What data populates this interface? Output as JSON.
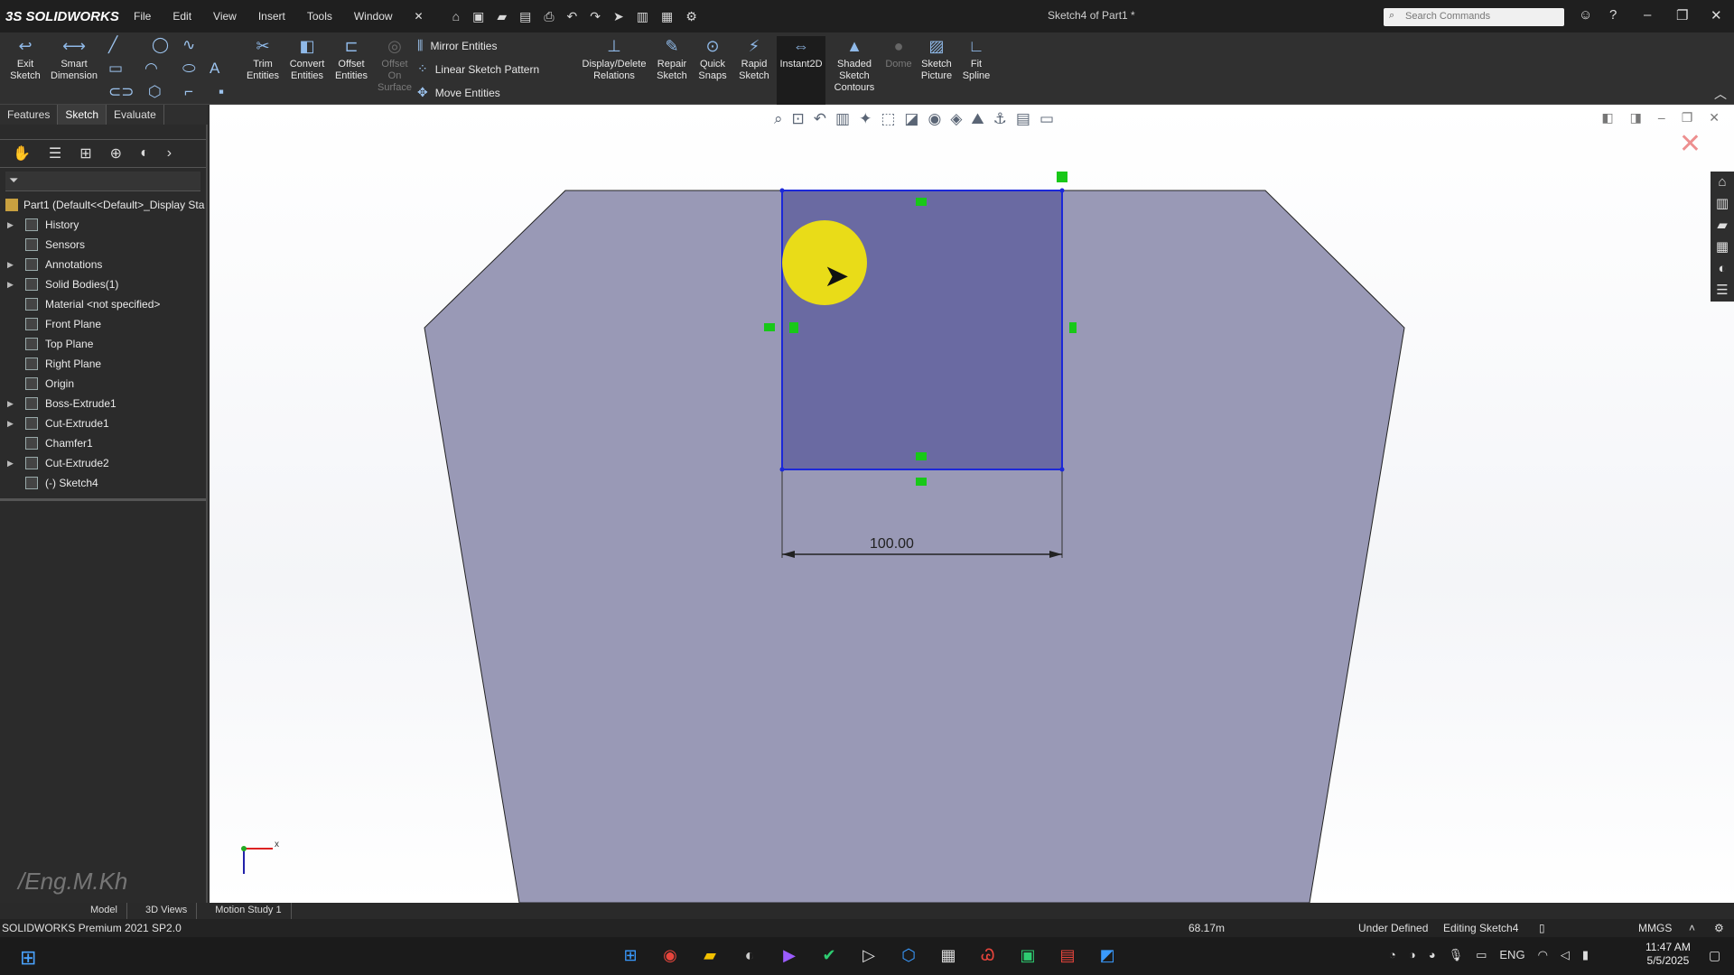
{
  "app": {
    "logo": "3S SOLIDWORKS",
    "document_title": "Sketch4 of Part1 *",
    "menu": [
      "File",
      "Edit",
      "View",
      "Insert",
      "Tools",
      "Window"
    ],
    "search_placeholder": "Search Commands"
  },
  "commands": {
    "exit_sketch": "Exit\nSketch",
    "smart_dimension": "Smart\nDimension",
    "trim": "Trim\nEntities",
    "convert": "Convert\nEntities",
    "offset": "Offset\nEntities",
    "offset_surface": "Offset\nOn\nSurface",
    "mirror": "Mirror Entities",
    "linear_pattern": "Linear Sketch Pattern",
    "move": "Move Entities",
    "display_delete": "Display/Delete\nRelations",
    "repair": "Repair\nSketch",
    "quick_snaps": "Quick\nSnaps",
    "rapid_sketch": "Rapid\nSketch",
    "instant2d": "Instant2D",
    "shaded_contours": "Shaded\nSketch\nContours",
    "dome": "Dome",
    "sketch_picture": "Sketch\nPicture",
    "fit_spline": "Fit\nSpline"
  },
  "tabs": [
    "Features",
    "Sketch",
    "Evaluate"
  ],
  "active_tab": "Sketch",
  "tree": {
    "root": "Part1  (Default<<Default>_Display Sta",
    "nodes": [
      {
        "label": "History",
        "expandable": true
      },
      {
        "label": "Sensors",
        "expandable": false
      },
      {
        "label": "Annotations",
        "expandable": true
      },
      {
        "label": "Solid Bodies(1)",
        "expandable": true
      },
      {
        "label": "Material <not specified>",
        "expandable": false
      },
      {
        "label": "Front Plane",
        "expandable": false
      },
      {
        "label": "Top Plane",
        "expandable": false
      },
      {
        "label": "Right Plane",
        "expandable": false
      },
      {
        "label": "Origin",
        "expandable": false
      },
      {
        "label": "Boss-Extrude1",
        "expandable": true
      },
      {
        "label": "Cut-Extrude1",
        "expandable": true
      },
      {
        "label": "Chamfer1",
        "expandable": false
      },
      {
        "label": "Cut-Extrude2",
        "expandable": true
      },
      {
        "label": "(-) Sketch4",
        "expandable": false
      }
    ]
  },
  "watermark": "/Eng.M.Kh",
  "viewport": {
    "dimension_value": "100.00",
    "axis_x": "x",
    "axis_y": "y",
    "colors": {
      "part_face": "#9999b6",
      "sketch_fill": "#6a6aa2",
      "sketch_line": "#1c28d8",
      "relation": "#18c818"
    }
  },
  "bottom_tabs": [
    "Model",
    "3D Views",
    "Motion Study 1"
  ],
  "status": {
    "product": "SOLIDWORKS Premium 2021 SP2.0",
    "coord": "68.17m",
    "state": "Under Defined",
    "editing": "Editing Sketch4",
    "units": "MMGS"
  },
  "taskbar": {
    "lang": "ENG",
    "time": "11:47 AM",
    "date": "5/5/2025"
  }
}
